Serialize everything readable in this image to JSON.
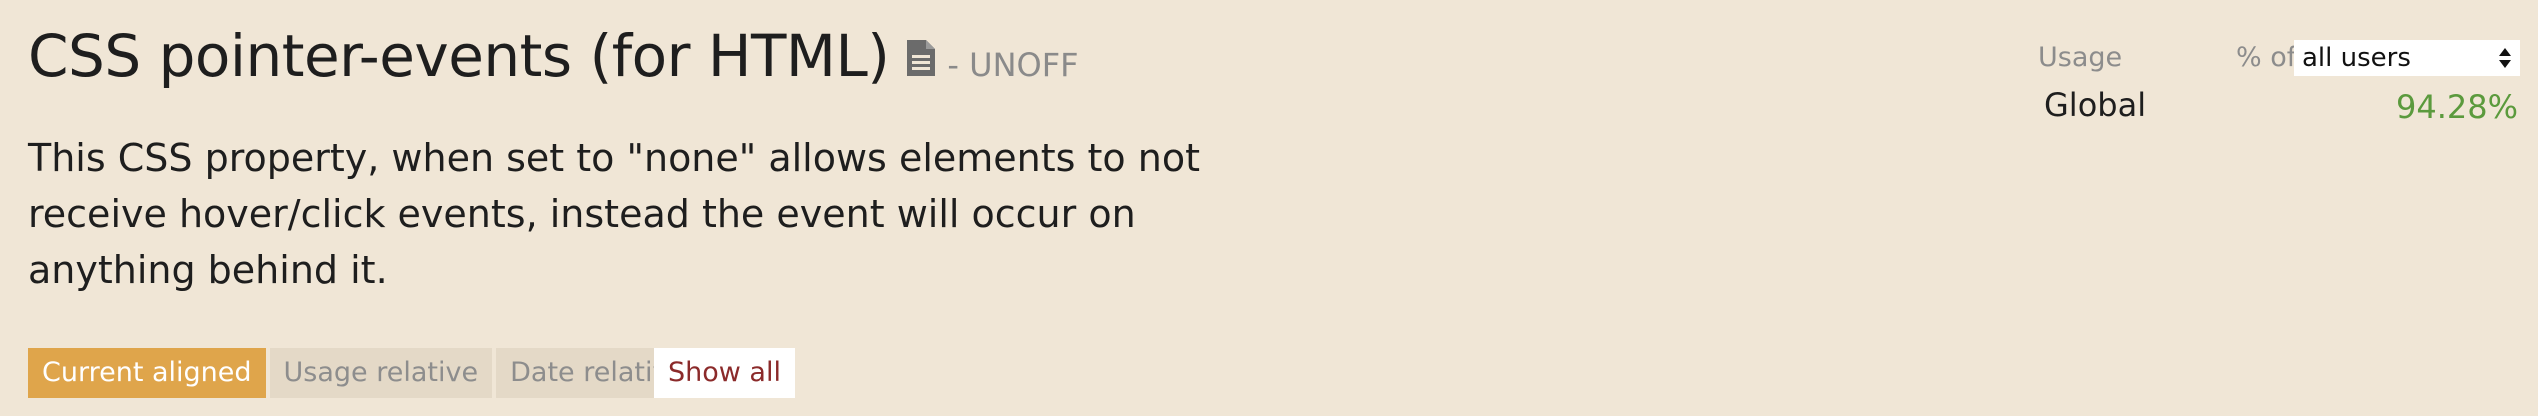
{
  "header": {
    "title": "CSS pointer-events (for HTML)",
    "status": "- UNOFF",
    "spec_icon": "document-icon"
  },
  "description": "This CSS property, when set to \"none\" allows elements to not receive hover/click events, instead the event will occur on anything behind it.",
  "tabs": [
    {
      "label": "Current aligned",
      "active": true
    },
    {
      "label": "Usage relative",
      "active": false
    },
    {
      "label": "Date relative",
      "active": false
    }
  ],
  "show_all_label": "Show all",
  "usage": {
    "label": "Usage",
    "percent_of_label": "% of",
    "users_select": {
      "selected": "all users"
    },
    "region": "Global",
    "global_percent": "94.28%"
  },
  "colors": {
    "background": "#f0e6d6",
    "active_tab": "#dfa54b",
    "inactive_tab": "#e4d9c7",
    "show_all_text": "#8b2a2a",
    "percent_green": "#5b9a3d"
  }
}
